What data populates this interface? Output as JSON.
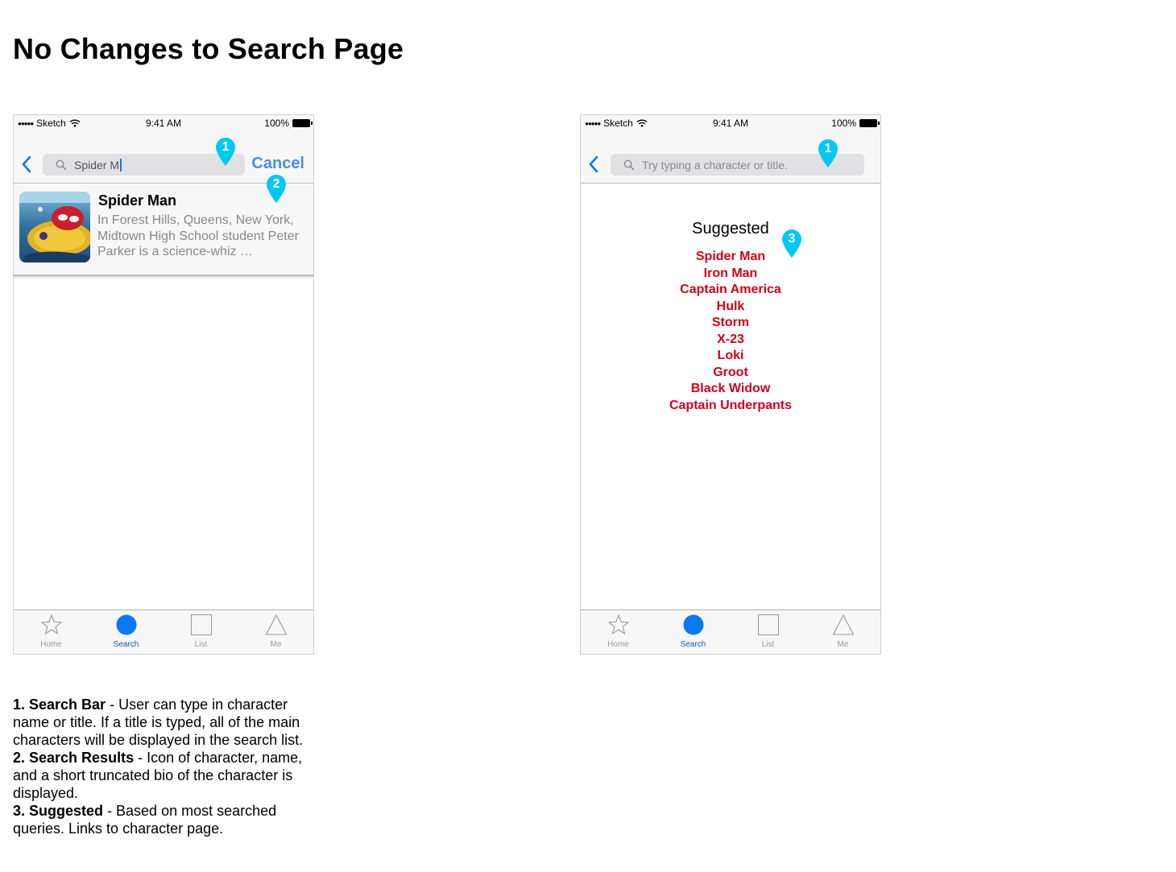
{
  "page_title": "No Changes to Search Page",
  "status_bar": {
    "carrier": "Sketch",
    "time": "9:41 AM",
    "battery": "100%"
  },
  "screen_results": {
    "search_value": "Spider M",
    "cancel_label": "Cancel",
    "result": {
      "name": "Spider Man",
      "bio": "In Forest Hills, Queens, New York, Midtown High School student Peter Parker is a science-whiz …"
    }
  },
  "screen_suggested": {
    "search_placeholder": "Try typing a character or title.",
    "suggested_heading": "Suggested",
    "suggested_items": [
      "Spider Man",
      "Iron Man",
      "Captain America",
      "Hulk",
      "Storm",
      "X-23",
      "Loki",
      "Groot",
      "Black Widow",
      "Captain Underpants"
    ]
  },
  "tab_bar": {
    "tabs": [
      {
        "label": "Home",
        "icon": "star-icon"
      },
      {
        "label": "Search",
        "icon": "circle-icon",
        "active": true
      },
      {
        "label": "List",
        "icon": "square-icon"
      },
      {
        "label": "Me",
        "icon": "triangle-icon"
      }
    ]
  },
  "markers": {
    "one": "1",
    "two": "2",
    "three": "3"
  },
  "notes": [
    {
      "title": "1. Search Bar",
      "text": " - User can type in character name or title. If a title is typed, all of the main characters will be displayed in the search list."
    },
    {
      "title": "2. Search Results",
      "text": " - Icon of character, name, and a short truncated bio of the character is displayed."
    },
    {
      "title": "3. Suggested",
      "text": " - Based on most searched queries. Links to character page."
    }
  ],
  "colors": {
    "accent_blue": "#0a60c4",
    "suggested_red": "#d0021b",
    "marker_cyan": "#00c8f0"
  }
}
